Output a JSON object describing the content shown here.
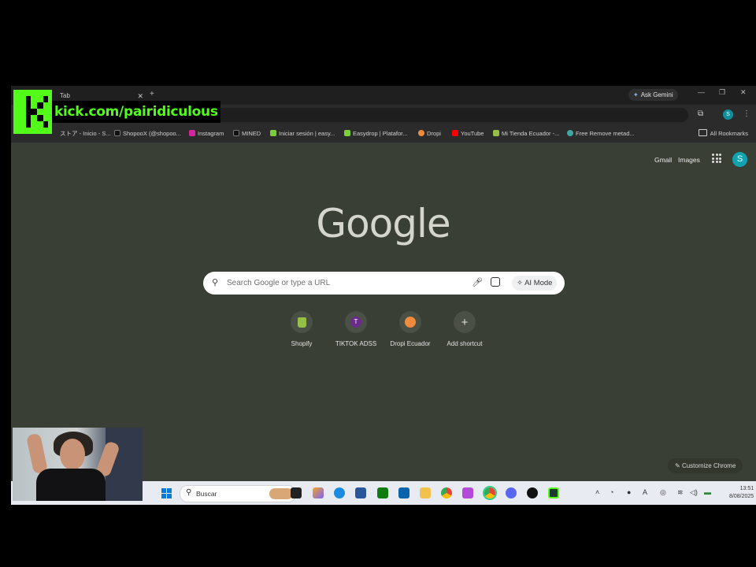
{
  "browser": {
    "tab_label": "Tab",
    "ask_gemini": "Ask Gemini",
    "avatar_letter": "S"
  },
  "bookmarks": [
    {
      "label": "ストア - Inicio - S...",
      "icon": "store-icon",
      "color": "#9aa0a6"
    },
    {
      "label": "ShopooX (@shopoo...",
      "icon": "tiktok-icon",
      "color": "#111111"
    },
    {
      "label": "Instagram",
      "icon": "instagram-icon",
      "color": "#d6249f"
    },
    {
      "label": "MINED",
      "icon": "mined-icon",
      "color": "#111111"
    },
    {
      "label": "Iniciar sesión | easy...",
      "icon": "easy-icon",
      "color": "#7bd03a"
    },
    {
      "label": "Easydrop | Platafor...",
      "icon": "easydrop-icon",
      "color": "#7bd03a"
    },
    {
      "label": "Dropi",
      "icon": "dropi-icon",
      "color": "#f08a3c"
    },
    {
      "label": "YouTube",
      "icon": "youtube-icon",
      "color": "#ff0000"
    },
    {
      "label": "Mi Tienda Ecuador -...",
      "icon": "shopify-icon",
      "color": "#95bf47"
    },
    {
      "label": "Free Remove metad...",
      "icon": "globe-icon",
      "color": "#3fa7a3"
    }
  ],
  "all_bookmarks": "All Rookmarks",
  "google": {
    "gmail": "Gmail",
    "images": "Images",
    "logo": "Google",
    "avatar_letter": "S",
    "search_placeholder": "Search Google or type a URL",
    "ai_mode": "AI Mode"
  },
  "shortcuts": [
    {
      "label": "Shopify",
      "icon": "shopify-icon",
      "glyph": "",
      "color": "#95bf47"
    },
    {
      "label": "TIKTOK ADSS",
      "icon": "t-letter-icon",
      "glyph": "T",
      "color": "#6a2b8a"
    },
    {
      "label": "Dropi Ecuador",
      "icon": "dropi-icon",
      "glyph": "",
      "color": "#f08a3c"
    },
    {
      "label": "Add shortcut",
      "icon": "plus-icon",
      "glyph": "+",
      "color": "#4a5045"
    }
  ],
  "customize": "Customize Chrome",
  "taskbar": {
    "search_text": "Buscar",
    "time": "13:51",
    "date": "8/08/2025"
  },
  "overlay": {
    "kick_url": "kick.com/pairidiculous"
  }
}
